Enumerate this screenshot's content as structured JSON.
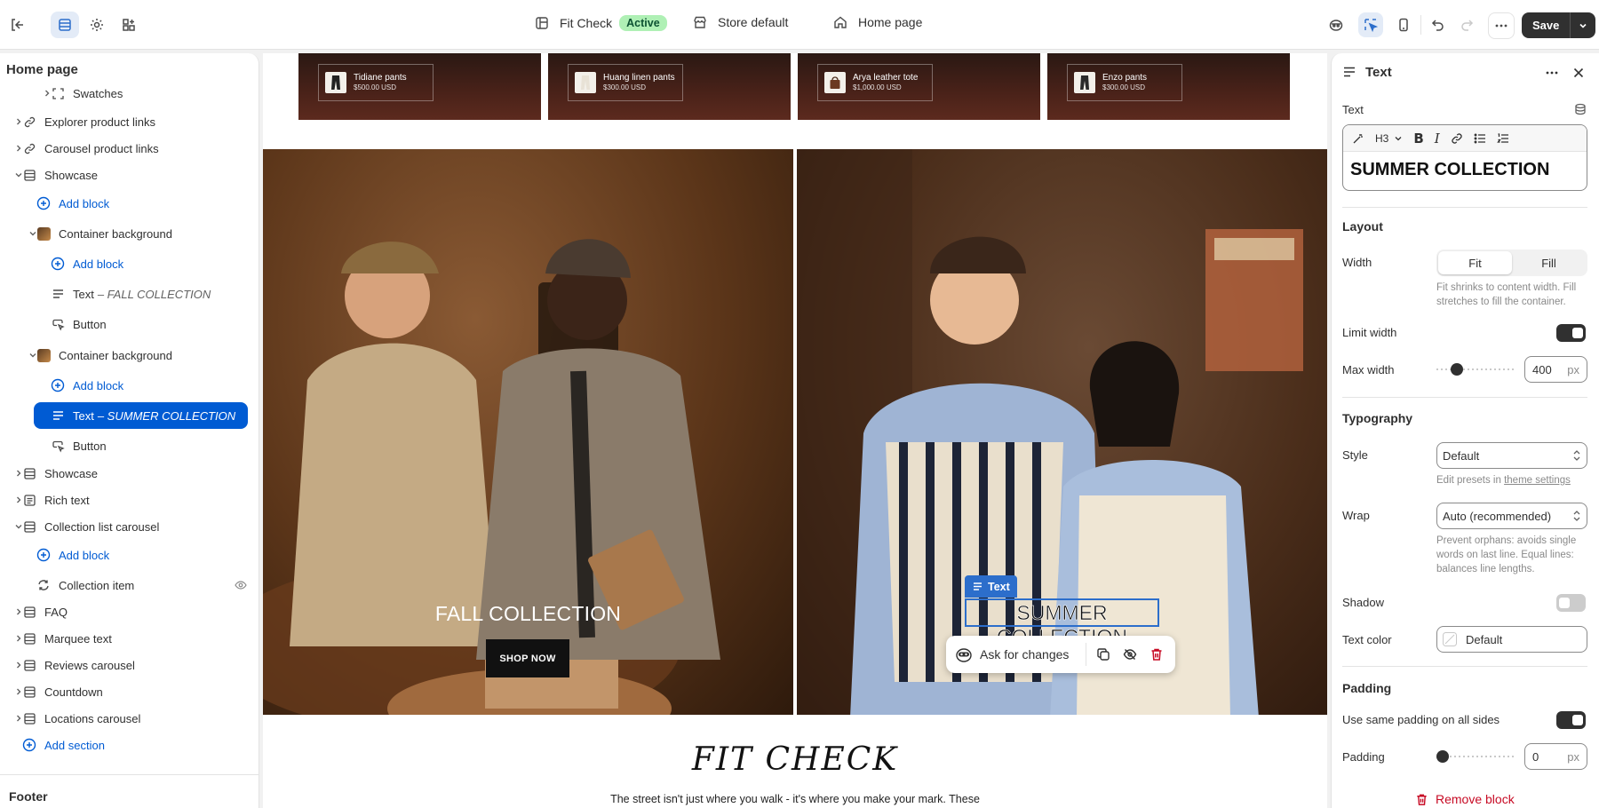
{
  "topbar": {
    "theme_name": "Fit Check",
    "theme_status": "Active",
    "store": "Store default",
    "page": "Home page",
    "save_label": "Save"
  },
  "sidebar": {
    "title": "Home page",
    "items": [
      {
        "label": "Swatches"
      },
      {
        "label": "Explorer product links"
      },
      {
        "label": "Carousel product links"
      },
      {
        "label": "Showcase"
      },
      {
        "label": "Add block"
      },
      {
        "label": "Container background"
      },
      {
        "label": "Add block"
      },
      {
        "label": "Text",
        "detail": "– FALL COLLECTION"
      },
      {
        "label": "Button"
      },
      {
        "label": "Container background"
      },
      {
        "label": "Add block"
      },
      {
        "label": "Text",
        "detail": "– SUMMER COLLECTION"
      },
      {
        "label": "Button"
      },
      {
        "label": "Showcase"
      },
      {
        "label": "Rich text"
      },
      {
        "label": "Collection list carousel"
      },
      {
        "label": "Add block"
      },
      {
        "label": "Collection item"
      },
      {
        "label": "FAQ"
      },
      {
        "label": "Marquee text"
      },
      {
        "label": "Reviews carousel"
      },
      {
        "label": "Countdown"
      },
      {
        "label": "Locations carousel"
      },
      {
        "label": "Add section"
      }
    ],
    "footer": "Footer"
  },
  "canvas": {
    "products": [
      {
        "name": "Tidiane pants",
        "price": "$500.00 USD"
      },
      {
        "name": "Huang linen pants",
        "price": "$300.00 USD"
      },
      {
        "name": "Arya leather tote",
        "price": "$1,000.00 USD"
      },
      {
        "name": "Enzo pants",
        "price": "$300.00 USD"
      }
    ],
    "hero_left_title": "FALL COLLECTION",
    "hero_left_button": "SHOP NOW",
    "hero_right_title": "SUMMER COLLECTION",
    "selected_label": "Text",
    "ask_label": "Ask for changes",
    "fit_title": "FIT CHECK",
    "fit_desc": "The street isn't just where you walk - it's where you make your mark. These"
  },
  "panel": {
    "title": "Text",
    "text_label": "Text",
    "heading_level": "H3",
    "text_value": "SUMMER COLLECTION",
    "layout_title": "Layout",
    "width_label": "Width",
    "width_options": [
      "Fit",
      "Fill"
    ],
    "width_selected": "Fit",
    "width_help": "Fit shrinks to content width. Fill stretches to fill the container.",
    "limit_width_label": "Limit width",
    "limit_width_on": true,
    "max_width_label": "Max width",
    "max_width_value": "400",
    "max_width_unit": "px",
    "typography_title": "Typography",
    "style_label": "Style",
    "style_value": "Default",
    "style_help_prefix": "Edit presets in ",
    "style_help_link": "theme settings",
    "wrap_label": "Wrap",
    "wrap_value": "Auto (recommended)",
    "wrap_help": "Prevent orphans: avoids single words on last line. Equal lines: balances line lengths.",
    "shadow_label": "Shadow",
    "shadow_on": false,
    "text_color_label": "Text color",
    "text_color_value": "Default",
    "padding_title": "Padding",
    "same_padding_label": "Use same padding on all sides",
    "same_padding_on": true,
    "padding_label": "Padding",
    "padding_value": "0",
    "padding_unit": "px",
    "remove_label": "Remove block"
  },
  "colors": {
    "accent": "#005bd3",
    "selection": "#2c6ecb",
    "danger": "#c70a24",
    "active_badge": "#aff0b5"
  }
}
